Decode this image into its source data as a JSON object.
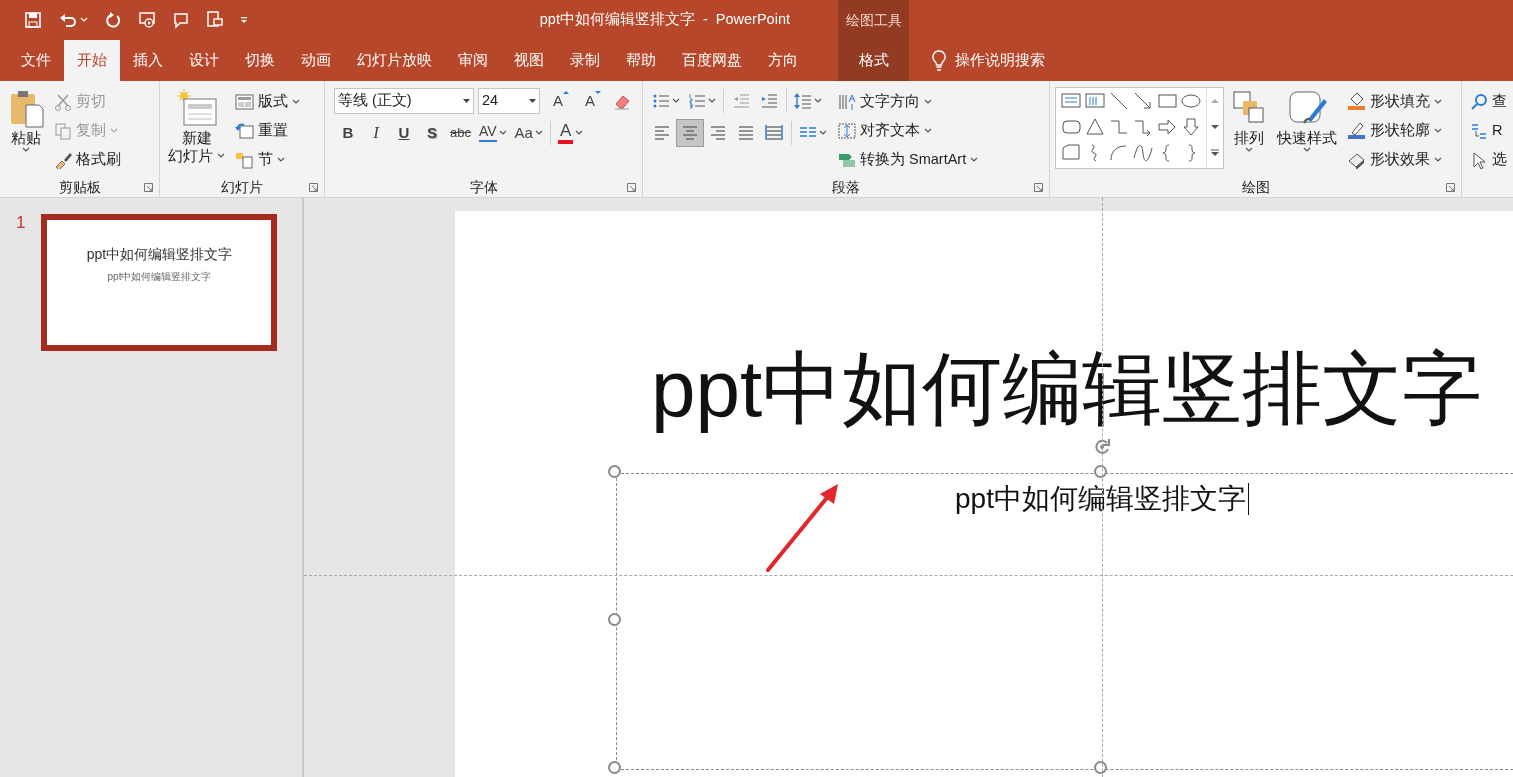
{
  "window": {
    "title": "ppt中如何编辑竖排文字  -  PowerPoint",
    "context_group": "绘图工具"
  },
  "tabs": [
    {
      "label": "文件",
      "selected": false,
      "kind": "normal"
    },
    {
      "label": "开始",
      "selected": true,
      "kind": "normal"
    },
    {
      "label": "插入",
      "selected": false,
      "kind": "normal"
    },
    {
      "label": "设计",
      "selected": false,
      "kind": "normal"
    },
    {
      "label": "切换",
      "selected": false,
      "kind": "normal"
    },
    {
      "label": "动画",
      "selected": false,
      "kind": "normal"
    },
    {
      "label": "幻灯片放映",
      "selected": false,
      "kind": "normal"
    },
    {
      "label": "审阅",
      "selected": false,
      "kind": "normal"
    },
    {
      "label": "视图",
      "selected": false,
      "kind": "normal"
    },
    {
      "label": "录制",
      "selected": false,
      "kind": "normal"
    },
    {
      "label": "帮助",
      "selected": false,
      "kind": "normal"
    },
    {
      "label": "百度网盘",
      "selected": false,
      "kind": "normal"
    },
    {
      "label": "方向",
      "selected": false,
      "kind": "normal"
    },
    {
      "label": "格式",
      "selected": false,
      "kind": "contextual"
    }
  ],
  "tell_me": "操作说明搜索",
  "clipboard": {
    "label": "剪贴板",
    "paste": "粘贴",
    "items": [
      {
        "label": "剪切",
        "kind": "cut",
        "disabled": true
      },
      {
        "label": "复制",
        "kind": "copy",
        "disabled": true
      },
      {
        "label": "格式刷",
        "kind": "brush",
        "disabled": false
      }
    ]
  },
  "slides_group": {
    "label": "幻灯片",
    "new_slide": [
      "新建",
      "幻灯片"
    ],
    "items": [
      {
        "label": "版式",
        "kind": "layout"
      },
      {
        "label": "重置",
        "kind": "reset"
      },
      {
        "label": "节",
        "kind": "section"
      }
    ]
  },
  "font": {
    "label": "字体",
    "name": "等线 (正文)",
    "size": "24",
    "grow": "A",
    "shrink": "A",
    "color_button": "A",
    "styles": [
      {
        "label": "B",
        "kind": "bold"
      },
      {
        "label": "I",
        "kind": "italic"
      },
      {
        "label": "U",
        "kind": "underline"
      },
      {
        "label": "S",
        "kind": "shadow"
      },
      {
        "label": "abc",
        "kind": "strike"
      },
      {
        "label": "AV",
        "kind": "spacing"
      },
      {
        "label": "Aa",
        "kind": "case"
      }
    ]
  },
  "paragraph": {
    "label": "段落",
    "alignments": [
      {
        "kind": "left",
        "selected": false
      },
      {
        "kind": "center",
        "selected": true
      },
      {
        "kind": "right",
        "selected": false
      },
      {
        "kind": "justify",
        "selected": false
      },
      {
        "kind": "distributed",
        "selected": false
      }
    ],
    "commands": [
      {
        "label": "文字方向",
        "kind": "direction"
      },
      {
        "label": "对齐文本",
        "kind": "align"
      },
      {
        "label": "转换为 SmartArt",
        "kind": "smartart"
      }
    ]
  },
  "drawing": {
    "label": "绘图",
    "arrange": "排列",
    "quick_styles": "快速样式",
    "commands": [
      {
        "label": "形状填充",
        "kind": "fill"
      },
      {
        "label": "形状轮廓",
        "kind": "outline"
      },
      {
        "label": "形状效果",
        "kind": "effect"
      }
    ]
  },
  "editing": {
    "commands": [
      {
        "label": "查",
        "kind": "find"
      },
      {
        "label": "R",
        "kind": "replace"
      },
      {
        "label": "选",
        "kind": "select"
      }
    ]
  },
  "slide_pane": {
    "slides": [
      {
        "number": "1",
        "title": "ppt中如何编辑竖排文字",
        "subtitle": "ppt中如何编辑竖排文字",
        "selected": true
      }
    ]
  },
  "slide": {
    "title": "ppt中如何编辑竖排文字",
    "subtitle": "ppt中如何编辑竖排文字"
  }
}
